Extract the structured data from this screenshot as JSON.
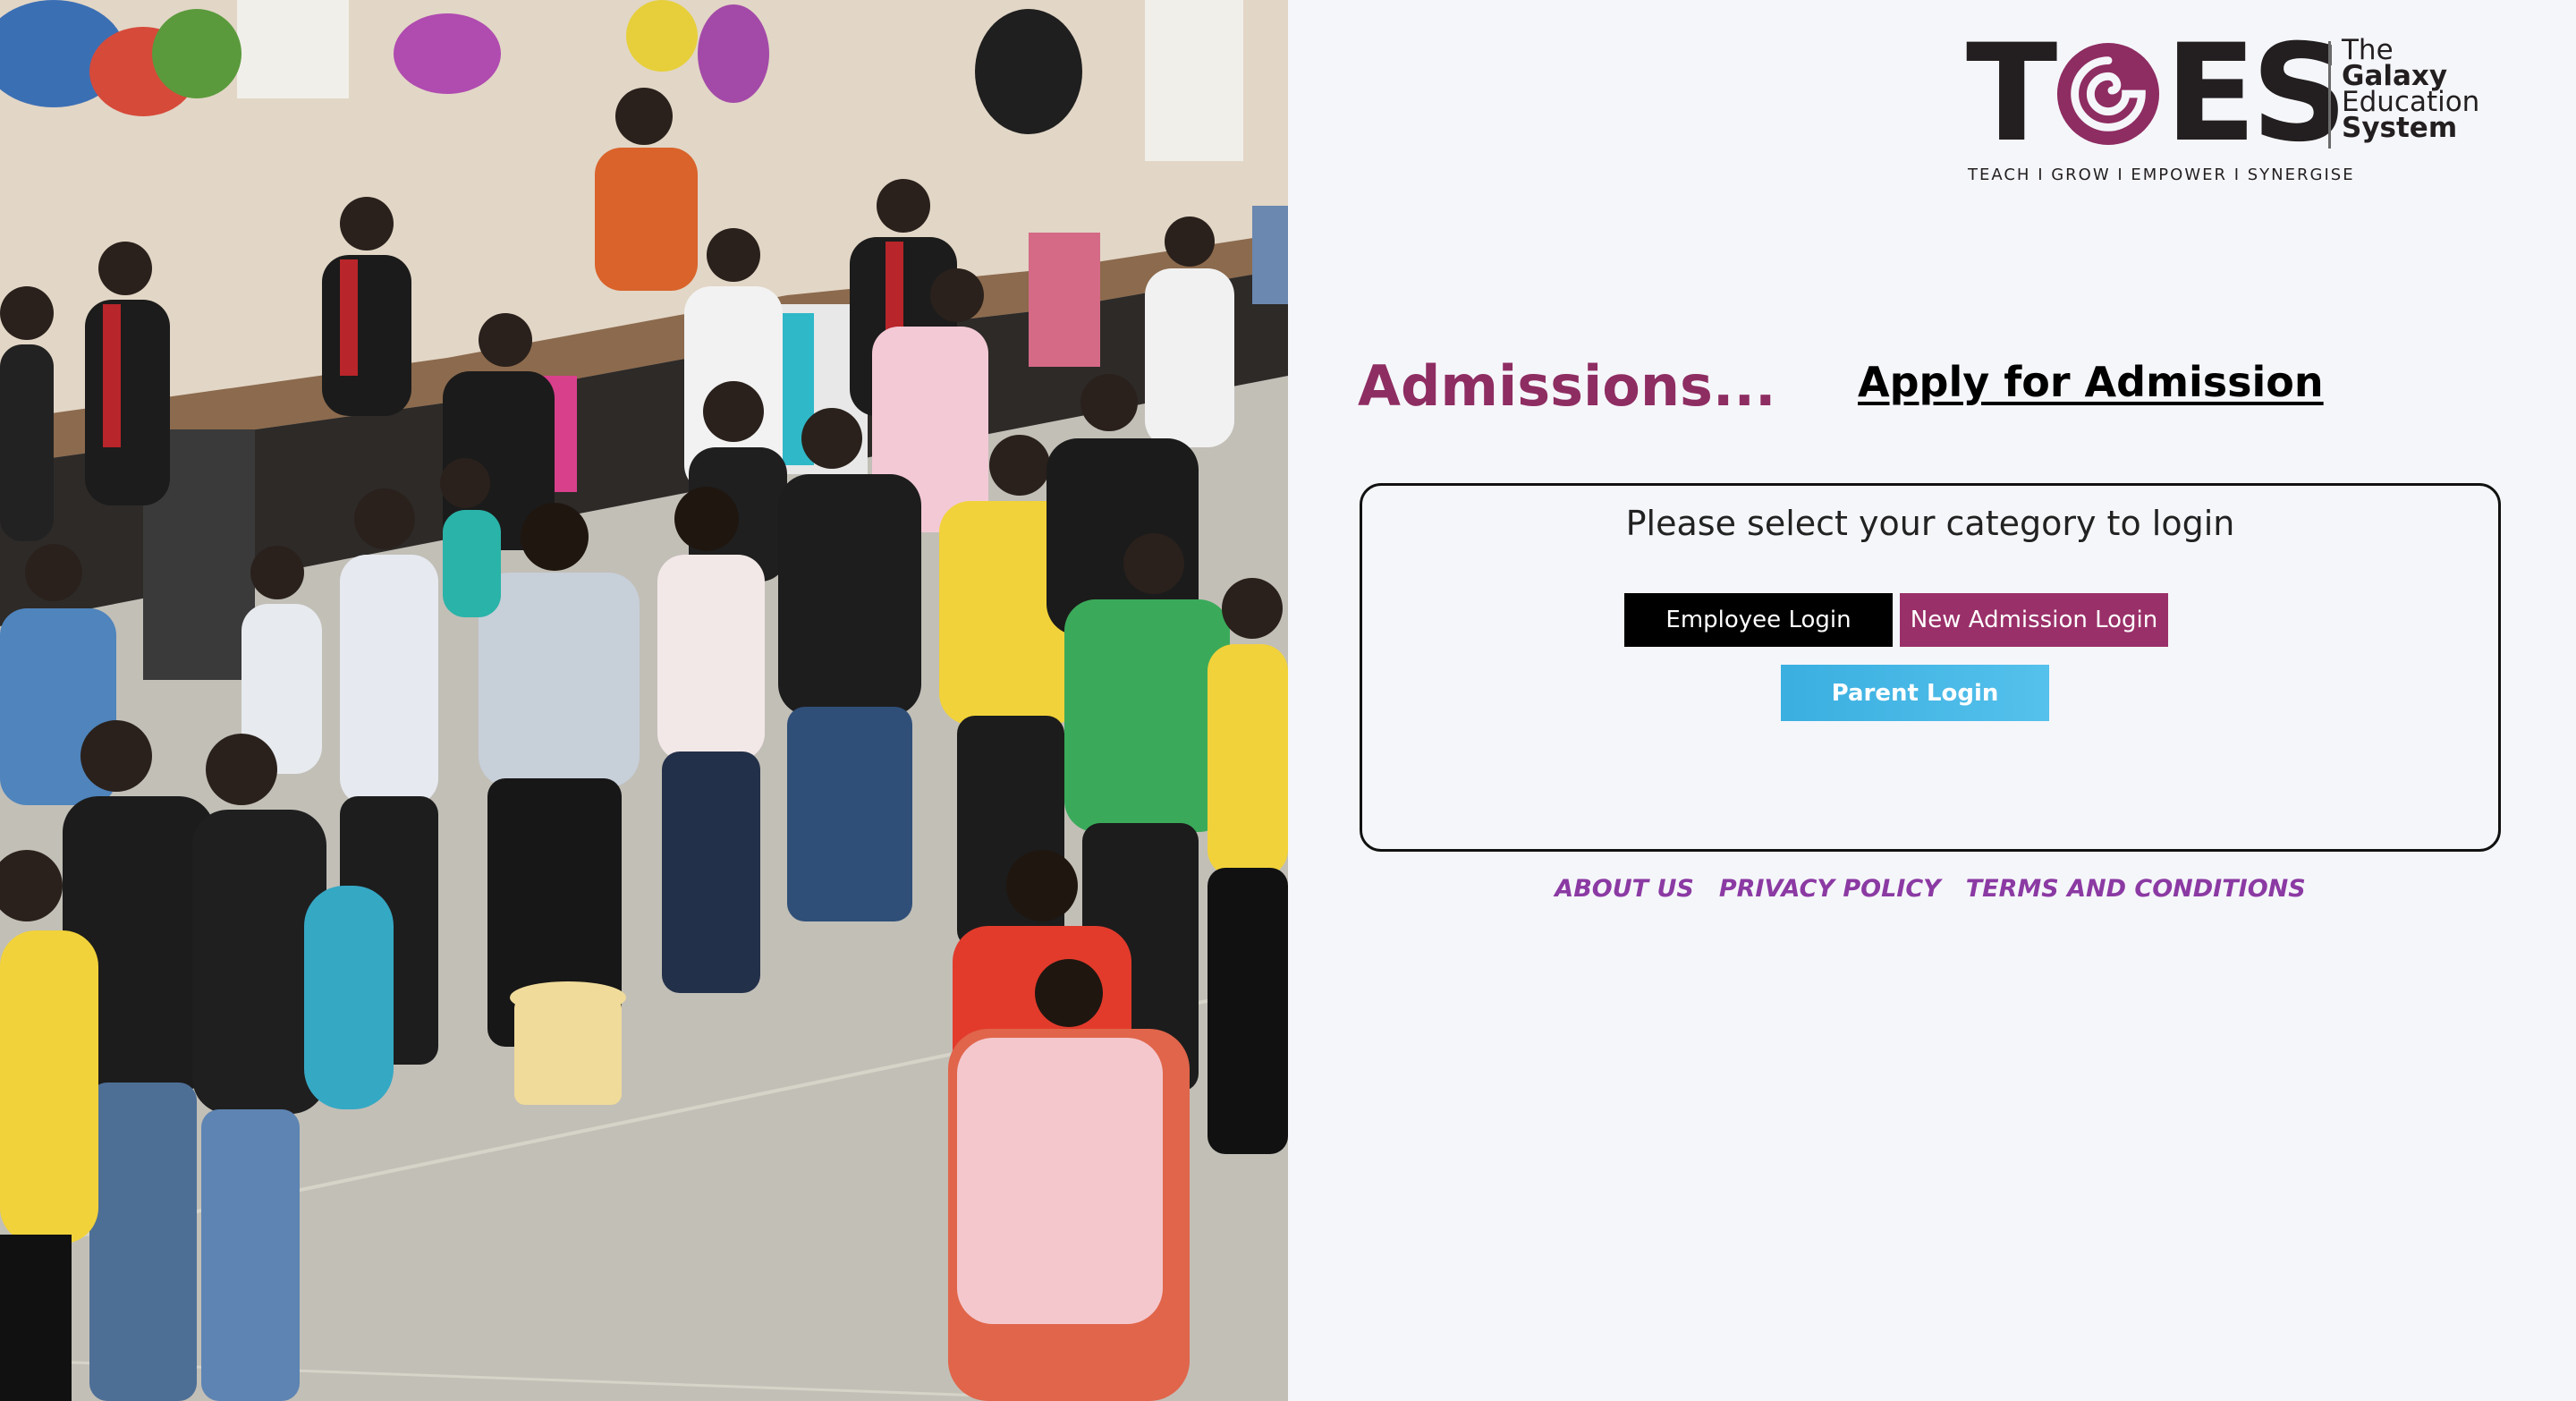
{
  "colors": {
    "accent_plum": "#8e2d62",
    "admission_button": "#9a3069",
    "employee_button": "#000000",
    "parent_button": "#3aafe0",
    "footer_link": "#8b3aa3",
    "page_background": "#f5f6fa"
  },
  "hero": {
    "description_icon": "campus-crowd-photo"
  },
  "logo": {
    "letters_left": "T",
    "letters_right": "ES",
    "swirl_icon": "swirl-g-icon",
    "brand_line1": "The",
    "brand_line2": "Galaxy",
    "brand_line3": "Education",
    "brand_line4": "System",
    "tagline": "TEACH I GROW I EMPOWER I SYNERGISE"
  },
  "heading": {
    "title": "Admissions...",
    "apply_link": "Apply for Admission"
  },
  "login": {
    "prompt": "Please select your category to login",
    "employee_button": "Employee Login",
    "new_admission_button": "New Admission Login",
    "parent_button": "Parent Login"
  },
  "footer": {
    "about": "ABOUT US",
    "privacy": "PRIVACY POLICY",
    "terms": "TERMS AND CONDITIONS"
  }
}
